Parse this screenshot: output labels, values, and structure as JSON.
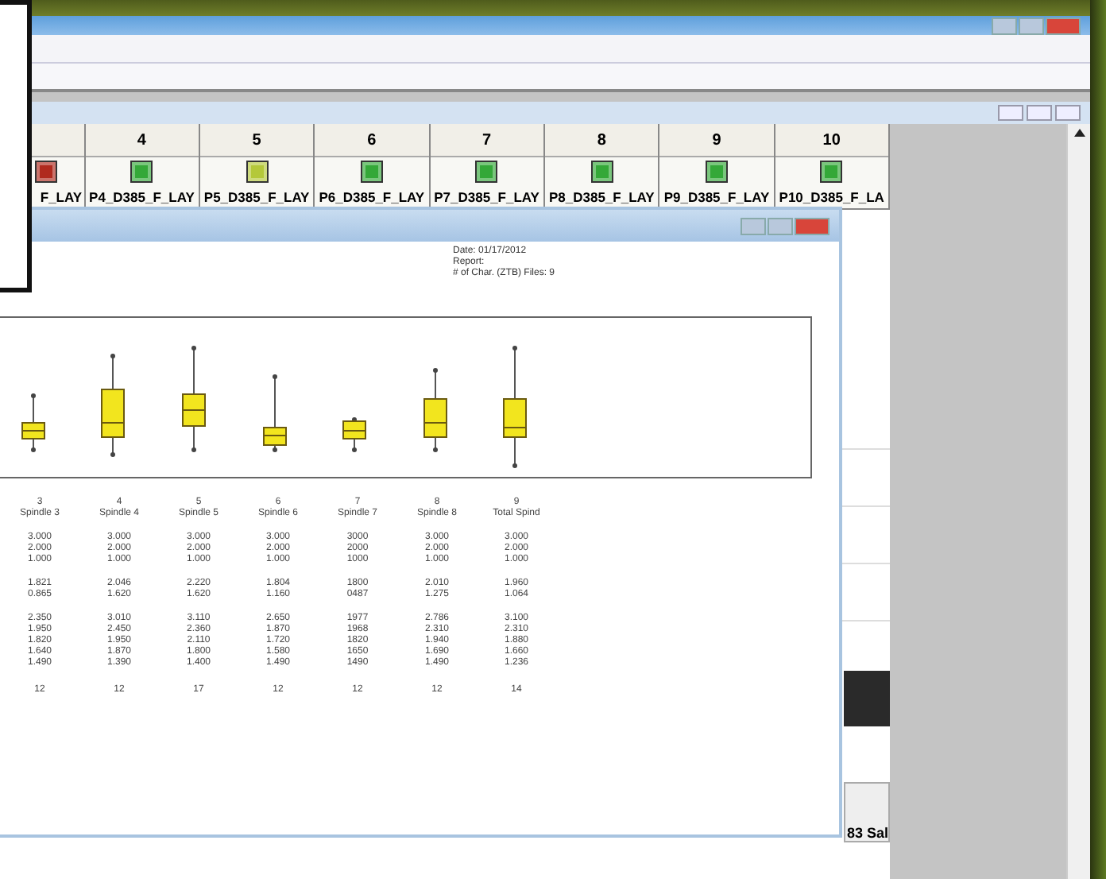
{
  "grid": {
    "columns": [
      {
        "color": "#b02a1e",
        "label": "F_LAY"
      },
      {
        "number": "4",
        "color": "#34a838",
        "label": "P4_D385_F_LAY"
      },
      {
        "number": "5",
        "color": "#b4c83a",
        "label": "P5_D385_F_LAY"
      },
      {
        "number": "6",
        "color": "#34a838",
        "label": "P6_D385_F_LAY"
      },
      {
        "number": "7",
        "color": "#34a838",
        "label": "P7_D385_F_LAY"
      },
      {
        "number": "8",
        "color": "#34a838",
        "label": "P8_D385_F_LAY"
      },
      {
        "number": "9",
        "color": "#34a838",
        "label": "P9_D385_F_LAY"
      },
      {
        "number": "10",
        "color": "#34a838",
        "label": "P10_D385_F_LA"
      }
    ],
    "side_button": "83 Sal"
  },
  "report": {
    "header_lines": [
      "Date: 01/17/2012",
      "Report:",
      "# of Char. (ZTB) Files: 9"
    ],
    "columns": [
      {
        "index": "3",
        "name": "Spindle 3",
        "limits": [
          "3.000",
          "2.000",
          "1.000"
        ],
        "stats": [
          "1.821",
          "0.865"
        ],
        "values": [
          "2.350",
          "1.950",
          "1.820",
          "1.640",
          "1.490"
        ],
        "count": "12"
      },
      {
        "index": "4",
        "name": "Spindle 4",
        "limits": [
          "3.000",
          "2.000",
          "1.000"
        ],
        "stats": [
          "2.046",
          "1.620"
        ],
        "values": [
          "3.010",
          "2.450",
          "1.950",
          "1.870",
          "1.390"
        ],
        "count": "12"
      },
      {
        "index": "5",
        "name": "Spindle 5",
        "limits": [
          "3.000",
          "2.000",
          "1.000"
        ],
        "stats": [
          "2.220",
          "1.620"
        ],
        "values": [
          "3.110",
          "2.360",
          "2.110",
          "1.800",
          "1.400"
        ],
        "count": "17"
      },
      {
        "index": "6",
        "name": "Spindle 6",
        "limits": [
          "3.000",
          "2.000",
          "1.000"
        ],
        "stats": [
          "1.804",
          "1.160"
        ],
        "values": [
          "2.650",
          "1.870",
          "1.720",
          "1.580",
          "1.490"
        ],
        "count": "12"
      },
      {
        "index": "7",
        "name": "Spindle 7",
        "limits": [
          "3000",
          "2000",
          "1000"
        ],
        "stats": [
          "1800",
          "0487"
        ],
        "values": [
          "1977",
          "1968",
          "1820",
          "1650",
          "1490"
        ],
        "count": "12"
      },
      {
        "index": "8",
        "name": "Spindle 8",
        "limits": [
          "3.000",
          "2.000",
          "1.000"
        ],
        "stats": [
          "2.010",
          "1.275"
        ],
        "values": [
          "2.786",
          "2.310",
          "1.940",
          "1.690",
          "1.490"
        ],
        "count": "12"
      },
      {
        "index": "9",
        "name": "Total Spind",
        "limits": [
          "3.000",
          "2.000",
          "1.000"
        ],
        "stats": [
          "1.960",
          "1.064"
        ],
        "values": [
          "3.100",
          "2.310",
          "1.880",
          "1.660",
          "1.236"
        ],
        "count": "14"
      }
    ]
  }
}
